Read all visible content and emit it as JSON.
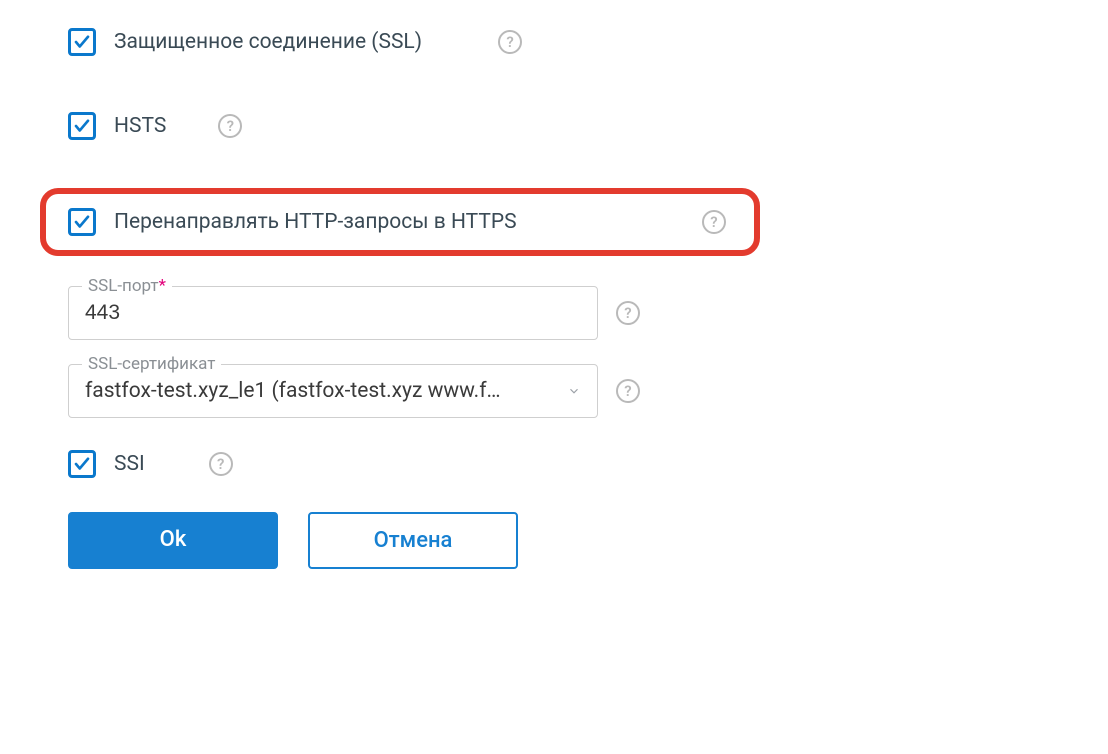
{
  "options": {
    "ssl_connection": {
      "label": "Защищенное соединение (SSL)",
      "checked": true
    },
    "hsts": {
      "label": "HSTS",
      "checked": true
    },
    "redirect_https": {
      "label": "Перенаправлять HTTP-запросы в HTTPS",
      "checked": true
    },
    "ssi": {
      "label": "SSI",
      "checked": true
    }
  },
  "fields": {
    "ssl_port": {
      "legend": "SSL-порт",
      "required": "*",
      "value": "443"
    },
    "ssl_cert": {
      "legend": "SSL-сертификат",
      "value": "fastfox-test.xyz_le1 (fastfox-test.xyz www.f…"
    }
  },
  "buttons": {
    "ok": "Ok",
    "cancel": "Отмена"
  }
}
